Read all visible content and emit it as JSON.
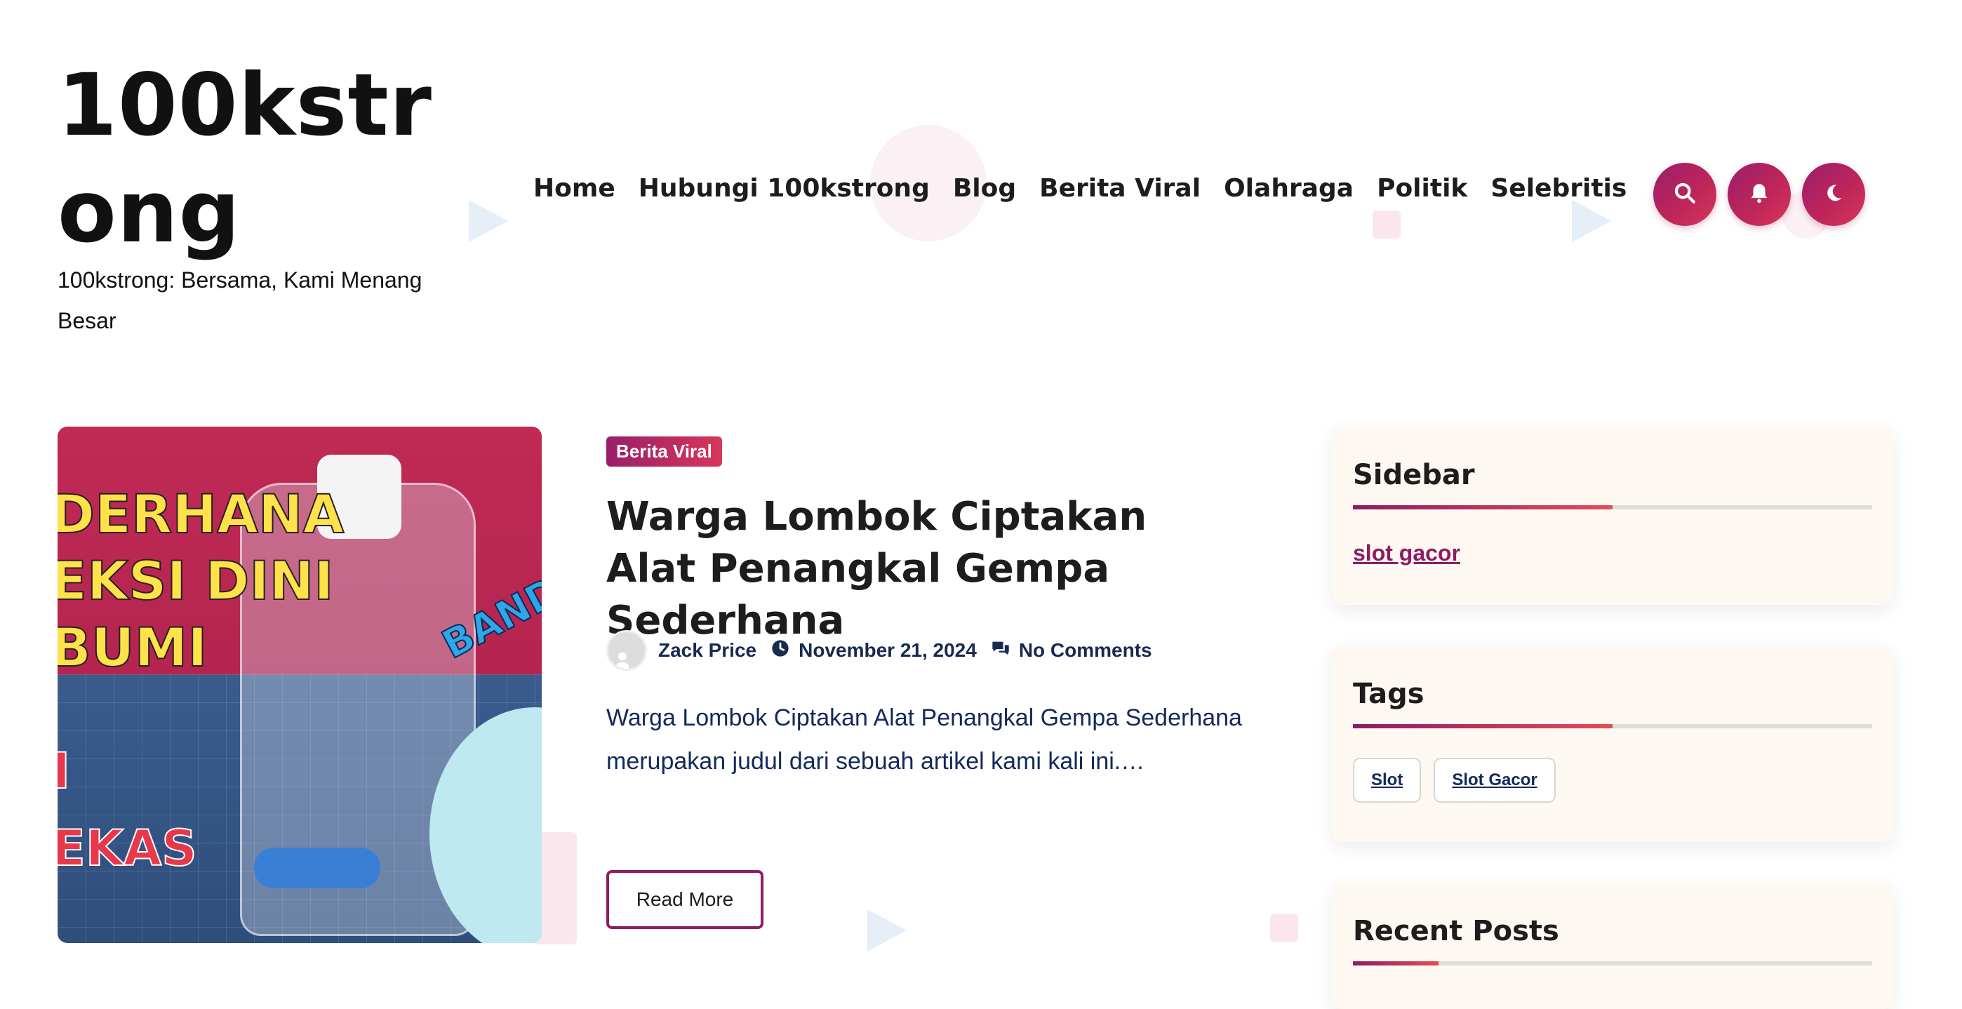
{
  "site": {
    "title": "100kstrong",
    "tagline": "100kstrong: Bersama, Kami Menang Besar"
  },
  "nav": {
    "items": [
      "Home",
      "Hubungi 100kstrong",
      "Blog",
      "Berita Viral",
      "Olahraga",
      "Politik",
      "Selebritis"
    ]
  },
  "header_icons": [
    "search-icon",
    "bell-icon",
    "moon-icon"
  ],
  "post": {
    "category": "Berita Viral",
    "title": "Warga Lombok Ciptakan Alat Penangkal Gempa Sederhana",
    "author": "Zack Price",
    "date": "November 21, 2024",
    "comments": "No Comments",
    "excerpt": "Warga Lombok Ciptakan Alat Penangkal Gempa Sederhana merupakan judul dari sebuah artikel kami kali ini.…",
    "read_more": "Read More",
    "thumbnail_text": {
      "line1": "DERHANA",
      "line2": "EKSI DINI",
      "line3": "BUMI",
      "line4": "I",
      "line5": "EKAS",
      "side": "BANDU"
    }
  },
  "sidebar": {
    "widgets": [
      {
        "title": "Sidebar",
        "link": "slot gacor"
      },
      {
        "title": "Tags",
        "tags": [
          "Slot",
          "Slot Gacor"
        ]
      },
      {
        "title": "Recent Posts"
      }
    ]
  },
  "colors": {
    "accent_start": "#9a1e6a",
    "accent_end": "#d7375a",
    "text_dark": "#1d1d1d",
    "text_navy": "#12295b",
    "widget_bg": "#fdf8f2"
  }
}
